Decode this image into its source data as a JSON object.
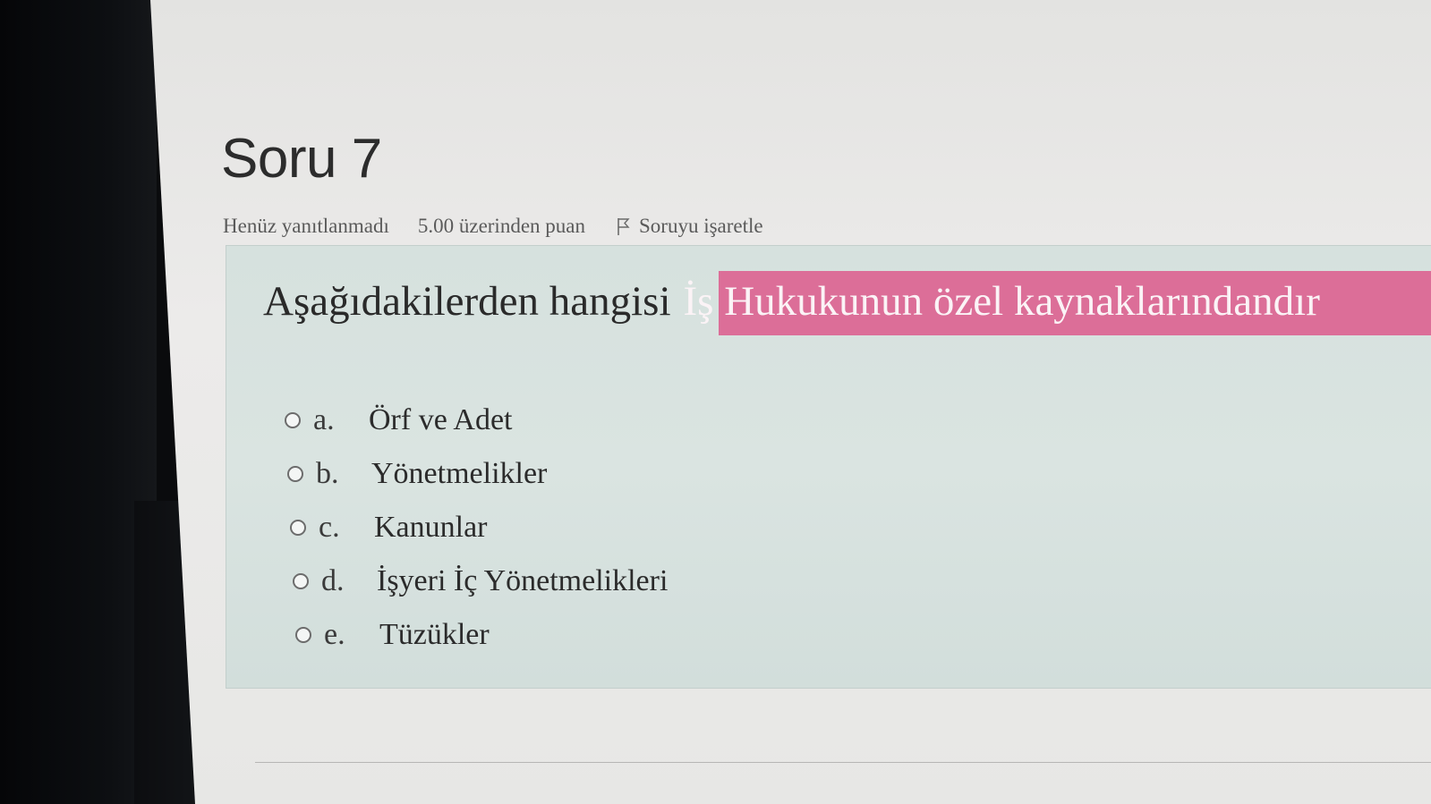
{
  "question": {
    "title": "Soru 7",
    "state": "Henüz yanıtlanmadı",
    "grade": "5.00 üzerinden puan",
    "flag_label": "Soruyu işaretle",
    "flag_icon": "flag-icon",
    "text_plain": "Aşağıdakilerden hangisi",
    "text_highlighted": "İş Hukukunun özel kaynaklarındandır",
    "highlight_color": "#dc6e98"
  },
  "answers": [
    {
      "letter": "a.",
      "label": "Örf ve Adet"
    },
    {
      "letter": "b.",
      "label": "Yönetmelikler"
    },
    {
      "letter": "c.",
      "label": "Kanunlar"
    },
    {
      "letter": "d.",
      "label": "İşyeri İç Yönetmelikleri"
    },
    {
      "letter": "e.",
      "label": "Tüzükler"
    }
  ]
}
